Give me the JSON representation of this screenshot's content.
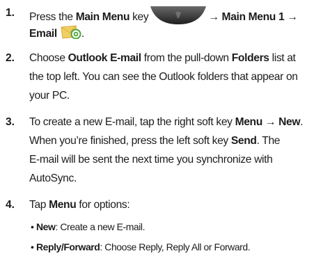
{
  "step1": {
    "number": "1.",
    "prefix": "Press the ",
    "main_menu_key": "Main Menu",
    "key_text": " key",
    "path": "→ Main Menu 1 →",
    "email": "Email",
    "period": ".",
    "icons": [
      "main-menu-key-icon",
      "email-envelope-icon"
    ],
    "colors": {
      "key": "#3a3a3a",
      "envelope": "#f2cf63",
      "at_sign": "#4aa53a"
    }
  },
  "step2": {
    "number": "2.",
    "l1_a": "Choose ",
    "l1_b": "Outlook E-mail",
    "l1_c": " from the pull-down ",
    "l1_d": "Folders",
    "l1_e": " list at",
    "l2": "the top left. You can see the Outlook folders that appear on",
    "l3": "your PC."
  },
  "step3": {
    "number": "3.",
    "l1_a": "To create a new E-mail, tap the right soft key ",
    "l1_b": "Menu → New",
    "l1_c": ".",
    "l2_a": "When you’re finished, press the left soft key ",
    "l2_b": "Send",
    "l2_c": ". The",
    "l3": "E-mail will be sent the next time you synchronize with",
    "l4": "AutoSync."
  },
  "step4": {
    "number": "4.",
    "l1_a": "Tap ",
    "l1_b": "Menu",
    "l1_c": " for options:",
    "bullets": [
      {
        "term": "New",
        "desc": ": Create a new E-mail."
      },
      {
        "term": "Reply/Forward",
        "desc": ": Choose Reply, Reply All or Forward."
      }
    ]
  }
}
